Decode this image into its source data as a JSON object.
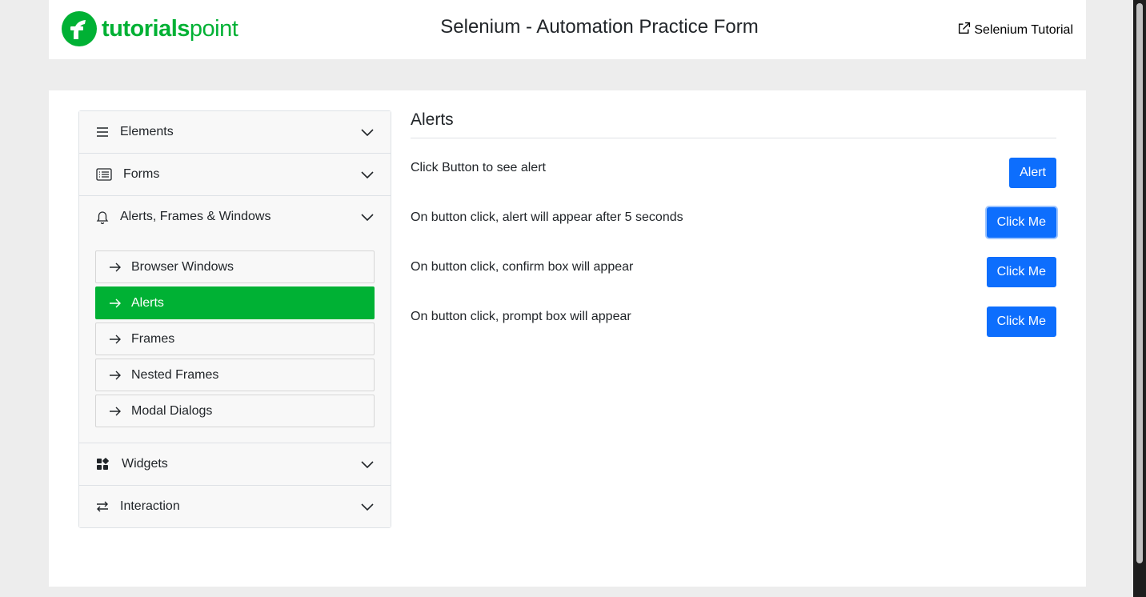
{
  "header": {
    "logo_bold": "tutorials",
    "logo_light": "point",
    "title": "Selenium - Automation Practice Form",
    "external_link": "Selenium Tutorial"
  },
  "sidebar": {
    "sections": [
      {
        "label": "Elements",
        "icon": "menu-lines-icon"
      },
      {
        "label": "Forms",
        "icon": "list-form-icon"
      },
      {
        "label": "Alerts, Frames & Windows",
        "icon": "bell-icon"
      },
      {
        "label": "Widgets",
        "icon": "widgets-grid-icon"
      },
      {
        "label": "Interaction",
        "icon": "swap-arrows-icon"
      }
    ],
    "submenu": [
      {
        "label": "Browser Windows",
        "active": false
      },
      {
        "label": "Alerts",
        "active": true
      },
      {
        "label": "Frames",
        "active": false
      },
      {
        "label": "Nested Frames",
        "active": false
      },
      {
        "label": "Modal Dialogs",
        "active": false
      }
    ]
  },
  "main": {
    "title": "Alerts",
    "rows": [
      {
        "text": "Click Button to see alert",
        "button": "Alert"
      },
      {
        "text": "On button click, alert will appear after 5 seconds",
        "button": "Click Me"
      },
      {
        "text": "On button click, confirm box will appear",
        "button": "Click Me"
      },
      {
        "text": "On button click, prompt box will appear",
        "button": "Click Me"
      }
    ]
  },
  "colors": {
    "brand_green": "#00b134",
    "button_blue": "#0d6efd"
  }
}
